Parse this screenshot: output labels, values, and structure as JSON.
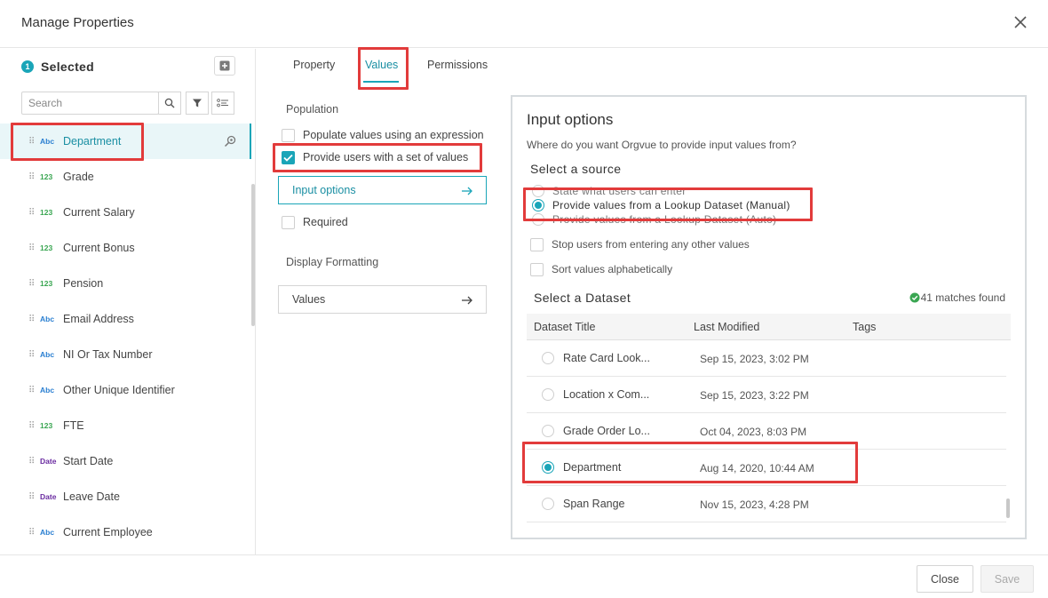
{
  "dialog": {
    "title": "Manage Properties"
  },
  "left": {
    "selected_count": "1",
    "selected_label": "Selected",
    "search_placeholder": "Search",
    "items": [
      {
        "type": "Abc",
        "kind": "abc",
        "label": "Department",
        "active": true
      },
      {
        "type": "123",
        "kind": "num",
        "label": "Grade"
      },
      {
        "type": "123",
        "kind": "num",
        "label": "Current Salary"
      },
      {
        "type": "123",
        "kind": "num",
        "label": "Current Bonus"
      },
      {
        "type": "123",
        "kind": "num",
        "label": "Pension"
      },
      {
        "type": "Abc",
        "kind": "abc",
        "label": "Email Address"
      },
      {
        "type": "Abc",
        "kind": "abc",
        "label": "NI Or Tax Number"
      },
      {
        "type": "Abc",
        "kind": "abc",
        "label": "Other Unique Identifier"
      },
      {
        "type": "123",
        "kind": "num",
        "label": "FTE"
      },
      {
        "type": "Date",
        "kind": "date",
        "label": "Start Date"
      },
      {
        "type": "Date",
        "kind": "date",
        "label": "Leave Date"
      },
      {
        "type": "Abc",
        "kind": "abc",
        "label": "Current Employee"
      }
    ]
  },
  "tabs": [
    {
      "label": "Property"
    },
    {
      "label": "Values",
      "active": true
    },
    {
      "label": "Permissions"
    }
  ],
  "middle": {
    "population_label": "Population",
    "populate_expression": "Populate values using an expression",
    "provide_set": "Provide users with a set of values",
    "input_options_btn": "Input options",
    "required": "Required",
    "display_formatting_label": "Display Formatting",
    "values_btn": "Values"
  },
  "input_options": {
    "title": "Input options",
    "subtitle": "Where do you want Orgvue to provide input values from?",
    "select_source": "Select a source",
    "sources": [
      {
        "label": "State what users can enter",
        "selected": false
      },
      {
        "label": "Provide values from a Lookup Dataset (Manual)",
        "selected": true
      },
      {
        "label": "Provide values from a Lookup Dataset (Auto)",
        "selected": false
      }
    ],
    "stop_users": "Stop users from entering any other values",
    "sort_alpha": "Sort values alphabetically",
    "select_dataset": "Select a Dataset",
    "matches": "41 matches found",
    "columns": [
      "Dataset Title",
      "Last Modified",
      "Tags"
    ],
    "rows": [
      {
        "title": "Rate Card Look...",
        "modified": "Sep 15, 2023, 3:02 PM",
        "selected": false
      },
      {
        "title": "Location x Com...",
        "modified": "Sep 15, 2023, 3:22 PM",
        "selected": false
      },
      {
        "title": "Grade Order Lo...",
        "modified": "Oct 04, 2023, 8:03 PM",
        "selected": false
      },
      {
        "title": "Department",
        "modified": "Aug 14, 2020, 10:44 AM",
        "selected": true
      },
      {
        "title": "Span Range",
        "modified": "Nov 15, 2023, 4:28 PM",
        "selected": false
      }
    ]
  },
  "footer": {
    "close_label": "Close",
    "save_label": "Save"
  },
  "colors": {
    "accent": "#1aa5b8",
    "highlight": "#e23b3b"
  }
}
